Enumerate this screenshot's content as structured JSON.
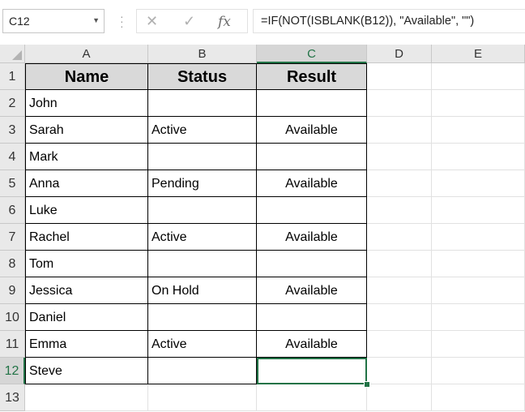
{
  "name_box": {
    "value": "C12"
  },
  "formula_bar": {
    "cancel_icon": "✕",
    "enter_icon": "✓",
    "fx_label": "fx",
    "formula": "=IF(NOT(ISBLANK(B12)), \"Available\", \"\")"
  },
  "columns": [
    "A",
    "B",
    "C",
    "D",
    "E"
  ],
  "active_column": "C",
  "active_row": "12",
  "row_numbers": [
    "1",
    "2",
    "3",
    "4",
    "5",
    "6",
    "7",
    "8",
    "9",
    "10",
    "11",
    "12",
    "13"
  ],
  "table": {
    "headers": [
      "Name",
      "Status",
      "Result"
    ],
    "rows": [
      [
        "John",
        "",
        ""
      ],
      [
        "Sarah",
        "Active",
        "Available"
      ],
      [
        "Mark",
        "",
        ""
      ],
      [
        "Anna",
        "Pending",
        "Available"
      ],
      [
        "Luke",
        "",
        ""
      ],
      [
        "Rachel",
        "Active",
        "Available"
      ],
      [
        "Tom",
        "",
        ""
      ],
      [
        "Jessica",
        "On Hold",
        "Available"
      ],
      [
        "Daniel",
        "",
        ""
      ],
      [
        "Emma",
        "Active",
        "Available"
      ],
      [
        "Steve",
        "",
        ""
      ]
    ]
  },
  "colors": {
    "header_fill": "#d9d9d9",
    "selection": "#217346"
  }
}
